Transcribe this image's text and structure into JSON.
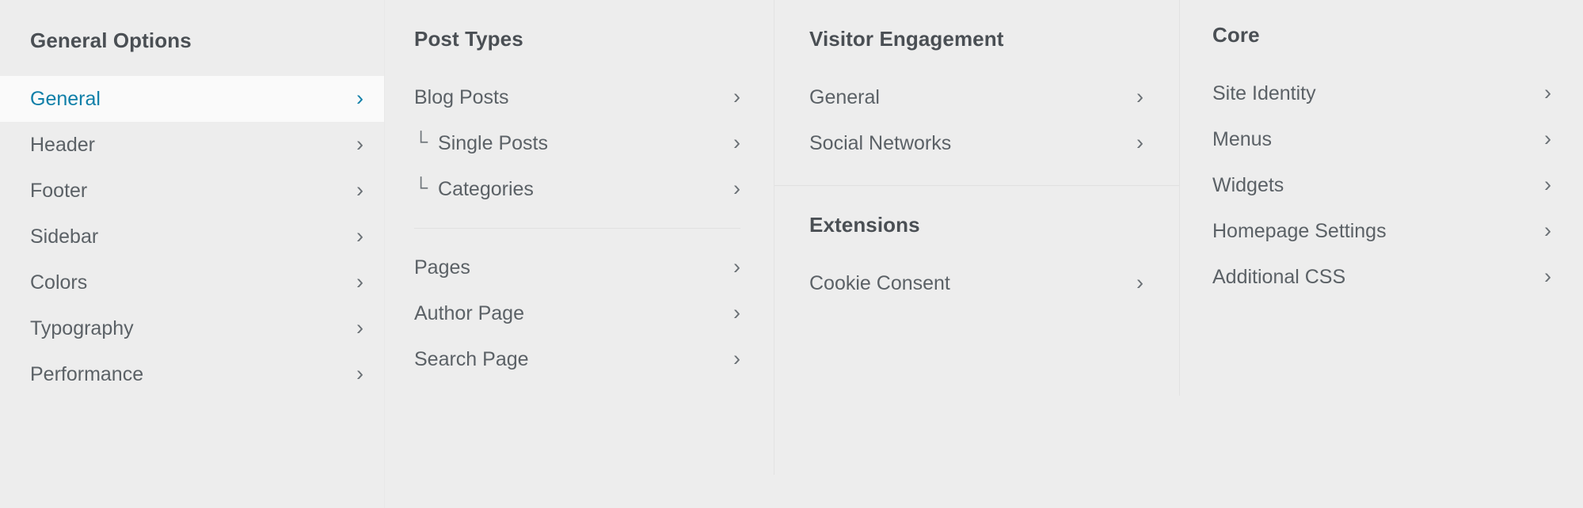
{
  "accent_color": "#0f7fa8",
  "background_color": "#ededed",
  "active_background_color": "#fafafa",
  "text_color": "#5b6166",
  "heading_color": "#4a4f54",
  "chevron_glyph": "›",
  "branch_glyph": "└",
  "columns": [
    {
      "heading": "General Options",
      "sections": [
        {
          "items": [
            {
              "label": "General",
              "active": true,
              "sub": false
            },
            {
              "label": "Header",
              "active": false,
              "sub": false
            },
            {
              "label": "Footer",
              "active": false,
              "sub": false
            },
            {
              "label": "Sidebar",
              "active": false,
              "sub": false
            },
            {
              "label": "Colors",
              "active": false,
              "sub": false
            },
            {
              "label": "Typography",
              "active": false,
              "sub": false
            },
            {
              "label": "Performance",
              "active": false,
              "sub": false
            }
          ]
        }
      ]
    },
    {
      "heading": "Post Types",
      "sections": [
        {
          "items": [
            {
              "label": "Blog Posts",
              "active": false,
              "sub": false
            },
            {
              "label": "Single Posts",
              "active": false,
              "sub": true
            },
            {
              "label": "Categories",
              "active": false,
              "sub": true
            }
          ]
        },
        {
          "items": [
            {
              "label": "Pages",
              "active": false,
              "sub": false
            },
            {
              "label": "Author Page",
              "active": false,
              "sub": false
            },
            {
              "label": "Search Page",
              "active": false,
              "sub": false
            }
          ]
        }
      ]
    },
    {
      "heading": "Visitor Engagement",
      "heading2": "Extensions",
      "sections": [
        {
          "items": [
            {
              "label": "General",
              "active": false,
              "sub": false
            },
            {
              "label": "Social Networks",
              "active": false,
              "sub": false
            }
          ]
        },
        {
          "items": [
            {
              "label": "Cookie Consent",
              "active": false,
              "sub": false
            }
          ]
        }
      ]
    },
    {
      "heading": "Core",
      "sections": [
        {
          "items": [
            {
              "label": "Site Identity",
              "active": false,
              "sub": false
            },
            {
              "label": "Menus",
              "active": false,
              "sub": false
            },
            {
              "label": "Widgets",
              "active": false,
              "sub": false
            },
            {
              "label": "Homepage Settings",
              "active": false,
              "sub": false
            },
            {
              "label": "Additional CSS",
              "active": false,
              "sub": false
            }
          ]
        }
      ]
    }
  ]
}
